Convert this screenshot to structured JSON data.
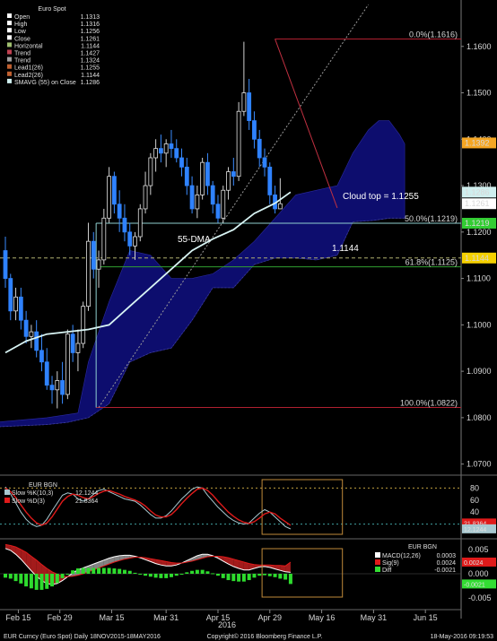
{
  "footer": {
    "left": "EUR Curncy (Euro Spot)  Daily 18NOV2015-18MAY2016",
    "center": "Copyright© 2016 Bloomberg Finance L.P.",
    "right": "18-May-2016 09:19:53"
  },
  "legend": {
    "title": "Euro Spot",
    "rows": [
      {
        "label": "Open",
        "value": "1.1313",
        "color": "#ffffff"
      },
      {
        "label": "High",
        "value": "1.1316",
        "color": "#ffffff"
      },
      {
        "label": "Low",
        "value": "1.1256",
        "color": "#ffffff"
      },
      {
        "label": "Close",
        "value": "1.1261",
        "color": "#ffffff"
      },
      {
        "label": "Horizontal",
        "value": "1.1144",
        "color": "#a0c070"
      },
      {
        "label": "Trend",
        "value": "1.1427",
        "color": "#c04050"
      },
      {
        "label": "Trend",
        "value": "1.1324",
        "color": "#a0a0a0"
      },
      {
        "label": "Lead1(26)",
        "value": "1.1255",
        "color": "#c06030"
      },
      {
        "label": "Lead2(26)",
        "value": "1.1144",
        "color": "#c06030"
      },
      {
        "label": "SMAVG (55) on Close",
        "value": "1.1286",
        "color": "#cfeeee"
      }
    ]
  },
  "annotations": {
    "cloud_top": "Cloud top = 1.1255",
    "dma": "55-DMA",
    "level_1144": "1.1144",
    "year": "2016"
  },
  "chart_data": [
    {
      "type": "candlestick",
      "ylim": [
        1.068,
        1.17
      ],
      "y_ticks": [
        "1.1600",
        "1.1500",
        "1.1400",
        "1.1300",
        "1.1200",
        "1.1100",
        "1.1000",
        "1.0900",
        "1.0800",
        "1.0700"
      ],
      "x_ticks": [
        "Feb 15",
        "Feb 29",
        "Mar 15",
        "Mar 31",
        "Apr 15",
        "Apr 29",
        "May 16",
        "May 31",
        "Jun 15"
      ],
      "fib_levels": [
        {
          "label": "0.0%(1.1616)",
          "value": 1.1616
        },
        {
          "label": "50.0%(1.1219)",
          "value": 1.1219
        },
        {
          "label": "61.8%(1.1125)",
          "value": 1.1125
        },
        {
          "label": "100.0%(1.0822)",
          "value": 1.0822
        }
      ],
      "price_tags": [
        {
          "label": "1.1392",
          "value": 1.1392,
          "color": "#f5a623"
        },
        {
          "label": "1.1286",
          "value": 1.1286,
          "color": "#cfeeee"
        },
        {
          "label": "1.1261",
          "value": 1.1261,
          "color": "#ffffff"
        },
        {
          "label": "1.1219",
          "value": 1.1219,
          "color": "#32cd32"
        },
        {
          "label": "1.1144",
          "value": 1.1144,
          "color": "#f5d000"
        }
      ],
      "candles": [
        [
          1.116,
          1.119,
          1.108,
          1.11
        ],
        [
          1.11,
          1.111,
          1.101,
          1.103
        ],
        [
          1.103,
          1.108,
          1.101,
          1.106
        ],
        [
          1.106,
          1.108,
          1.099,
          1.101
        ],
        [
          1.101,
          1.103,
          1.096,
          1.0975
        ],
        [
          1.0975,
          1.1,
          1.095,
          1.0985
        ],
        [
          1.0985,
          1.101,
          1.093,
          1.0945
        ],
        [
          1.0945,
          1.098,
          1.09,
          1.092
        ],
        [
          1.092,
          1.095,
          1.086,
          1.087
        ],
        [
          1.087,
          1.089,
          1.083,
          1.086
        ],
        [
          1.086,
          1.09,
          1.082,
          1.088
        ],
        [
          1.088,
          1.092,
          1.083,
          1.085
        ],
        [
          1.085,
          1.099,
          1.084,
          1.098
        ],
        [
          1.098,
          1.1,
          1.092,
          1.094
        ],
        [
          1.094,
          1.099,
          1.09,
          1.096
        ],
        [
          1.096,
          1.105,
          1.095,
          1.104
        ],
        [
          1.104,
          1.122,
          1.103,
          1.118
        ],
        [
          1.118,
          1.12,
          1.11,
          1.112
        ],
        [
          1.112,
          1.116,
          1.108,
          1.114
        ],
        [
          1.114,
          1.125,
          1.113,
          1.123
        ],
        [
          1.123,
          1.134,
          1.122,
          1.132
        ],
        [
          1.132,
          1.133,
          1.124,
          1.126
        ],
        [
          1.126,
          1.129,
          1.12,
          1.123
        ],
        [
          1.123,
          1.126,
          1.118,
          1.12
        ],
        [
          1.12,
          1.122,
          1.115,
          1.117
        ],
        [
          1.117,
          1.12,
          1.114,
          1.119
        ],
        [
          1.119,
          1.126,
          1.118,
          1.125
        ],
        [
          1.125,
          1.133,
          1.124,
          1.13
        ],
        [
          1.13,
          1.137,
          1.128,
          1.136
        ],
        [
          1.136,
          1.14,
          1.133,
          1.138
        ],
        [
          1.138,
          1.141,
          1.135,
          1.137
        ],
        [
          1.137,
          1.14,
          1.134,
          1.139
        ],
        [
          1.139,
          1.142,
          1.136,
          1.138
        ],
        [
          1.138,
          1.14,
          1.135,
          1.136
        ],
        [
          1.136,
          1.138,
          1.132,
          1.134
        ],
        [
          1.134,
          1.136,
          1.128,
          1.13
        ],
        [
          1.13,
          1.132,
          1.124,
          1.125
        ],
        [
          1.125,
          1.13,
          1.123,
          1.128
        ],
        [
          1.128,
          1.136,
          1.127,
          1.135
        ],
        [
          1.135,
          1.137,
          1.128,
          1.13
        ],
        [
          1.13,
          1.131,
          1.124,
          1.126
        ],
        [
          1.126,
          1.128,
          1.122,
          1.123
        ],
        [
          1.123,
          1.13,
          1.122,
          1.129
        ],
        [
          1.129,
          1.134,
          1.127,
          1.133
        ],
        [
          1.133,
          1.136,
          1.13,
          1.132
        ],
        [
          1.132,
          1.148,
          1.131,
          1.146
        ],
        [
          1.146,
          1.161,
          1.145,
          1.15
        ],
        [
          1.15,
          1.153,
          1.142,
          1.144
        ],
        [
          1.144,
          1.146,
          1.138,
          1.14
        ],
        [
          1.14,
          1.142,
          1.134,
          1.136
        ],
        [
          1.136,
          1.138,
          1.132,
          1.134
        ],
        [
          1.134,
          1.135,
          1.126,
          1.128
        ],
        [
          1.128,
          1.13,
          1.124,
          1.125
        ],
        [
          1.125,
          1.1316,
          1.1256,
          1.1261
        ]
      ],
      "sma55": [
        [
          0,
          1.094
        ],
        [
          4,
          1.0965
        ],
        [
          8,
          1.098
        ],
        [
          12,
          1.0985
        ],
        [
          16,
          1.099
        ],
        [
          20,
          1.1
        ],
        [
          24,
          1.104
        ],
        [
          28,
          1.108
        ],
        [
          32,
          1.112
        ],
        [
          36,
          1.116
        ],
        [
          40,
          1.1185
        ],
        [
          44,
          1.1205
        ],
        [
          48,
          1.124
        ],
        [
          52,
          1.1262
        ],
        [
          55,
          1.1286
        ]
      ],
      "cloud_a": [
        [
          -2,
          1.079
        ],
        [
          8,
          1.08
        ],
        [
          14,
          1.081
        ],
        [
          16,
          1.092
        ],
        [
          20,
          1.105
        ],
        [
          24,
          1.116
        ],
        [
          28,
          1.115
        ],
        [
          32,
          1.11
        ],
        [
          36,
          1.11
        ],
        [
          40,
          1.111
        ],
        [
          44,
          1.114
        ],
        [
          48,
          1.118
        ],
        [
          52,
          1.123
        ],
        [
          56,
          1.128
        ],
        [
          60,
          1.129
        ],
        [
          64,
          1.13
        ],
        [
          67,
          1.137
        ],
        [
          70,
          1.142
        ],
        [
          72,
          1.144
        ],
        [
          74,
          1.144
        ],
        [
          76,
          1.141
        ],
        [
          77,
          1.139
        ]
      ],
      "cloud_b": [
        [
          77,
          1.123
        ],
        [
          74,
          1.123
        ],
        [
          71,
          1.1225
        ],
        [
          67,
          1.1222
        ],
        [
          64,
          1.115
        ],
        [
          60,
          1.114
        ],
        [
          56,
          1.1144
        ],
        [
          52,
          1.1144
        ],
        [
          48,
          1.113
        ],
        [
          44,
          1.108
        ],
        [
          40,
          1.108
        ],
        [
          36,
          1.101
        ],
        [
          32,
          1.095
        ],
        [
          28,
          1.094
        ],
        [
          24,
          1.092
        ],
        [
          20,
          1.083
        ],
        [
          16,
          1.08
        ],
        [
          12,
          1.079
        ],
        [
          8,
          1.0785
        ],
        [
          -2,
          1.078
        ]
      ]
    },
    {
      "type": "line",
      "title": "EUR BGN",
      "ylim": [
        0,
        100
      ],
      "y_ticks": [
        "80",
        "60",
        "40",
        "20"
      ],
      "levels": [
        80,
        20
      ],
      "series": [
        {
          "name": "Slow %K(10,3)",
          "value": "12.1244",
          "color": "#a8c8d0",
          "values": [
            82,
            70,
            55,
            40,
            28,
            20,
            16,
            18,
            28,
            42,
            55,
            68,
            72,
            70,
            62,
            58,
            62,
            70,
            76,
            78,
            74,
            70,
            66,
            62,
            60,
            58,
            52,
            44,
            36,
            30,
            30,
            34,
            42,
            52,
            62,
            70,
            78,
            82,
            80,
            68,
            58,
            48,
            40,
            32,
            26,
            22,
            20,
            22,
            30,
            38,
            44,
            40,
            32,
            24,
            16,
            12
          ]
        },
        {
          "name": "Slow %D(3)",
          "value": "21.8364",
          "color": "#e01a1a",
          "values": [
            80,
            74,
            64,
            52,
            40,
            30,
            22,
            18,
            22,
            32,
            45,
            58,
            66,
            70,
            68,
            64,
            62,
            66,
            71,
            75,
            76,
            73,
            70,
            66,
            63,
            60,
            56,
            50,
            42,
            35,
            32,
            32,
            36,
            44,
            54,
            63,
            71,
            78,
            80,
            76,
            68,
            58,
            49,
            40,
            33,
            27,
            23,
            21,
            24,
            30,
            37,
            40,
            37,
            30,
            24,
            18
          ]
        }
      ],
      "tags": [
        {
          "label": "21.8364",
          "value": 21.8364,
          "color": "#e01a1a"
        },
        {
          "label": "12.1244",
          "value": 12.1244,
          "color": "#a8c8d0"
        }
      ]
    },
    {
      "type": "bar",
      "title": "EUR BGN",
      "ylim": [
        -0.007,
        0.007
      ],
      "y_ticks": [
        "0.005",
        "0.000",
        "-0.005"
      ],
      "series": [
        {
          "name": "MACD(12,26)",
          "value": "0.0003",
          "color": "#ffffff",
          "values": [
            0.0052,
            0.0048,
            0.004,
            0.003,
            0.0018,
            0.0006,
            -0.0005,
            -0.0014,
            -0.002,
            -0.0022,
            -0.002,
            -0.0014,
            -0.0006,
            0.0002,
            0.0008,
            0.0012,
            0.0016,
            0.002,
            0.0024,
            0.0028,
            0.0032,
            0.0035,
            0.0037,
            0.0038,
            0.0038,
            0.0036,
            0.0033,
            0.0029,
            0.0025,
            0.0021,
            0.0018,
            0.0016,
            0.0016,
            0.0018,
            0.0022,
            0.0027,
            0.0032,
            0.0037,
            0.004,
            0.004,
            0.0037,
            0.0032,
            0.0026,
            0.002,
            0.0015,
            0.0011,
            0.0008,
            0.0008,
            0.0011,
            0.0014,
            0.0015,
            0.0013,
            0.001,
            0.0007,
            0.0004,
            0.0003
          ]
        },
        {
          "name": "Sig(9)",
          "value": "0.0024",
          "color": "#e01a1a",
          "values": [
            0.006,
            0.0058,
            0.0055,
            0.005,
            0.0044,
            0.0036,
            0.0028,
            0.0019,
            0.0011,
            0.0004,
            -0.0001,
            -0.0005,
            -0.0006,
            -0.0005,
            -0.0003,
            0.0,
            0.0004,
            0.0008,
            0.0012,
            0.0016,
            0.002,
            0.0024,
            0.0027,
            0.003,
            0.0032,
            0.0034,
            0.0034,
            0.0033,
            0.0031,
            0.0029,
            0.0027,
            0.0025,
            0.0023,
            0.0022,
            0.0022,
            0.0024,
            0.0026,
            0.0029,
            0.0032,
            0.0035,
            0.0036,
            0.0036,
            0.0035,
            0.0033,
            0.003,
            0.0027,
            0.0024,
            0.0021,
            0.0019,
            0.0018,
            0.0018,
            0.0018,
            0.0017,
            0.0017,
            0.0016,
            0.0024
          ]
        },
        {
          "name": "Diff",
          "value": "-0.0021",
          "color": "#33dd33",
          "values": [
            -0.0008,
            -0.001,
            -0.0015,
            -0.002,
            -0.0026,
            -0.003,
            -0.0033,
            -0.0033,
            -0.0031,
            -0.0026,
            -0.0019,
            -0.0009,
            0.0,
            0.0007,
            0.0011,
            0.0012,
            0.0012,
            0.0012,
            0.0012,
            0.0012,
            0.0012,
            0.0011,
            0.001,
            0.0008,
            0.0006,
            0.0002,
            -0.0001,
            -0.0004,
            -0.0006,
            -0.0008,
            -0.0009,
            -0.0009,
            -0.0007,
            -0.0004,
            0.0,
            0.0003,
            0.0006,
            0.0008,
            0.0008,
            0.0005,
            0.0001,
            -0.0004,
            -0.0009,
            -0.0013,
            -0.0015,
            -0.0016,
            -0.0016,
            -0.0013,
            -0.0008,
            -0.0004,
            -0.0003,
            -0.0005,
            -0.0007,
            -0.001,
            -0.0012,
            -0.0021
          ]
        }
      ],
      "tags": [
        {
          "label": "0.0024",
          "value": 0.0024,
          "color": "#e01a1a"
        },
        {
          "label": "-0.0021",
          "value": -0.0021,
          "color": "#33dd33"
        }
      ]
    }
  ]
}
